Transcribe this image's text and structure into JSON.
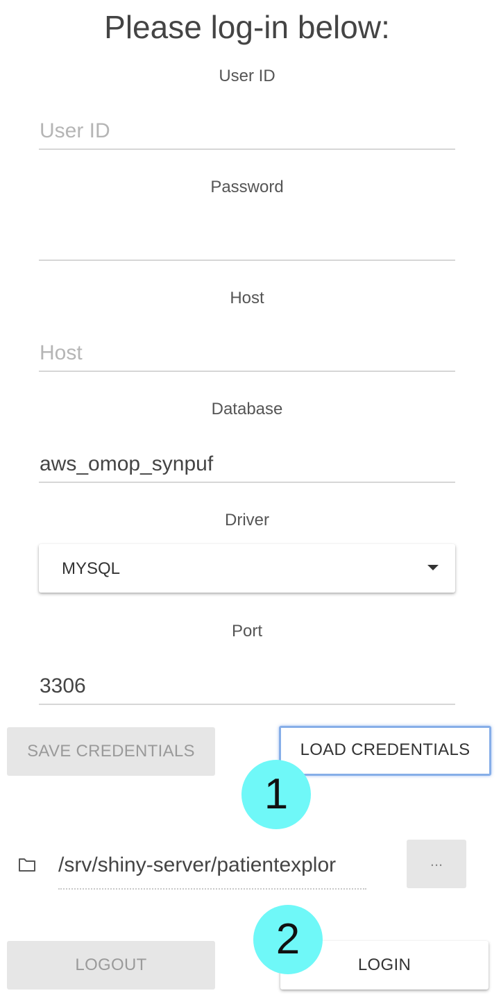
{
  "header": {
    "title": "Please log-in below:"
  },
  "form": {
    "user_id": {
      "label": "User ID",
      "placeholder": "User ID",
      "value": ""
    },
    "password": {
      "label": "Password",
      "value": ""
    },
    "host": {
      "label": "Host",
      "placeholder": "Host",
      "value": ""
    },
    "database": {
      "label": "Database",
      "value": "aws_omop_synpuf"
    },
    "driver": {
      "label": "Driver",
      "selected": "MYSQL"
    },
    "port": {
      "label": "Port",
      "value": "3306"
    }
  },
  "actions": {
    "save_credentials": "SAVE CREDENTIALS",
    "load_credentials": "LOAD CREDENTIALS",
    "browse": "...",
    "logout": "LOGOUT",
    "login": "LOGIN"
  },
  "file": {
    "path": "/srv/shiny-server/patientexplor",
    "icon": "folder-icon"
  },
  "annotations": {
    "step1": "1",
    "step2": "2",
    "color": "#6ff8f8"
  },
  "colors": {
    "focus_border": "#86aee8",
    "disabled_bg": "#e6e6e6"
  }
}
